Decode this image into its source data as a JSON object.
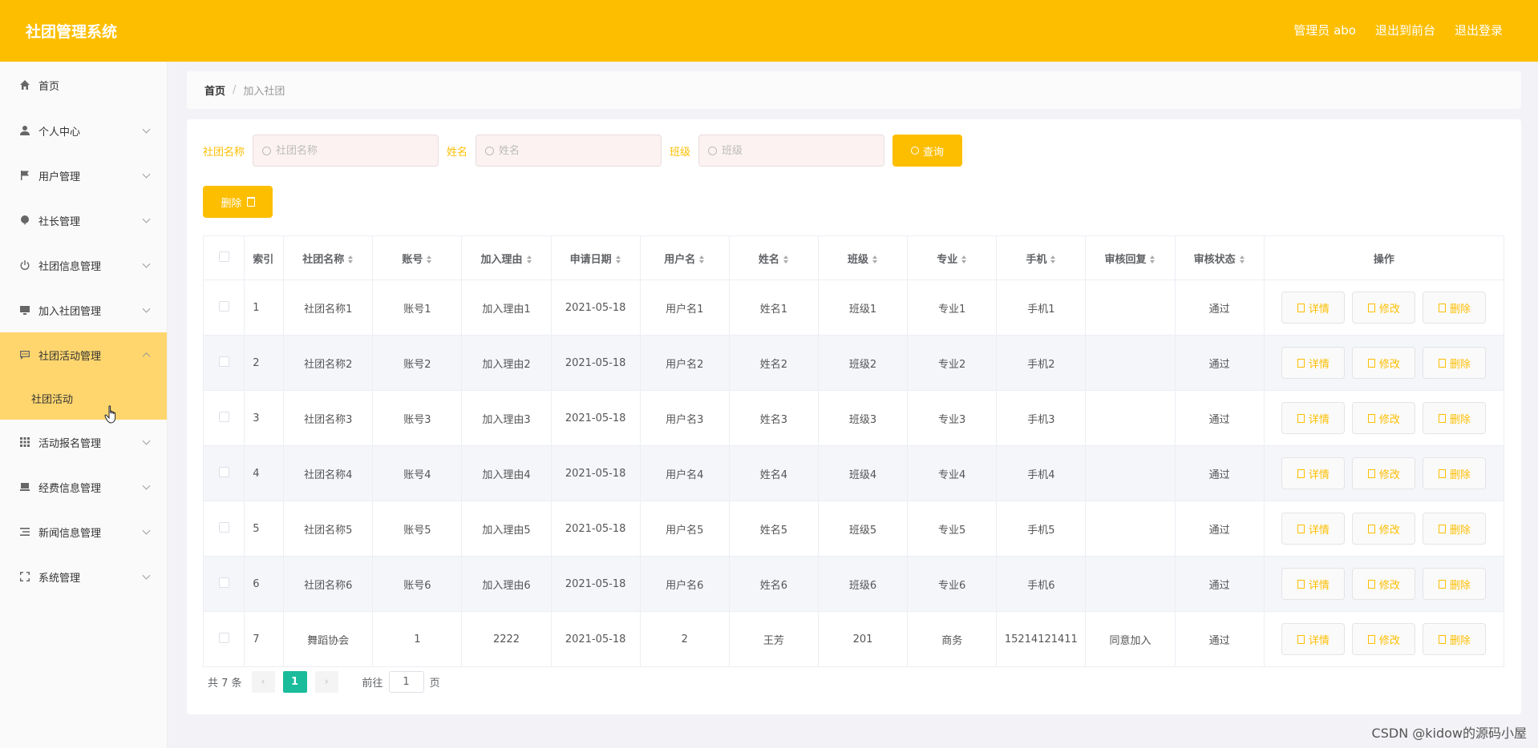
{
  "header": {
    "title": "社团管理系统",
    "admin_label": "管理员 abo",
    "to_front_label": "退出到前台",
    "logout_label": "退出登录"
  },
  "sidebar": {
    "items": [
      {
        "label": "首页",
        "icon": "home-icon"
      },
      {
        "label": "个人中心",
        "icon": "user-icon"
      },
      {
        "label": "用户管理",
        "icon": "flag-icon"
      },
      {
        "label": "社长管理",
        "icon": "balloon-icon"
      },
      {
        "label": "社团信息管理",
        "icon": "power-icon"
      },
      {
        "label": "加入社团管理",
        "icon": "monitor-icon"
      },
      {
        "label": "社团活动管理",
        "icon": "chat-icon"
      },
      {
        "label": "活动报名管理",
        "icon": "grid-icon"
      },
      {
        "label": "经费信息管理",
        "icon": "archive-icon"
      },
      {
        "label": "新闻信息管理",
        "icon": "list-icon"
      },
      {
        "label": "系统管理",
        "icon": "fullscreen-icon"
      }
    ],
    "sub_item": "社团活动"
  },
  "breadcrumb": {
    "home": "首页",
    "separator": "/",
    "current": "加入社团"
  },
  "search": {
    "club_label": "社团名称",
    "club_placeholder": "社团名称",
    "name_label": "姓名",
    "name_placeholder": "姓名",
    "class_label": "班级",
    "class_placeholder": "班级",
    "query_label": "查询"
  },
  "delete_label": "删除",
  "table": {
    "headers": [
      "索引",
      "社团名称",
      "账号",
      "加入理由",
      "申请日期",
      "用户名",
      "姓名",
      "班级",
      "专业",
      "手机",
      "审核回复",
      "审核状态",
      "操作"
    ],
    "rows": [
      {
        "index": "1",
        "club": "社团名称1",
        "account": "账号1",
        "reason": "加入理由1",
        "date": "2021-05-18",
        "username": "用户名1",
        "name": "姓名1",
        "class": "班级1",
        "major": "专业1",
        "phone": "手机1",
        "reply": "",
        "status": "通过"
      },
      {
        "index": "2",
        "club": "社团名称2",
        "account": "账号2",
        "reason": "加入理由2",
        "date": "2021-05-18",
        "username": "用户名2",
        "name": "姓名2",
        "class": "班级2",
        "major": "专业2",
        "phone": "手机2",
        "reply": "",
        "status": "通过"
      },
      {
        "index": "3",
        "club": "社团名称3",
        "account": "账号3",
        "reason": "加入理由3",
        "date": "2021-05-18",
        "username": "用户名3",
        "name": "姓名3",
        "class": "班级3",
        "major": "专业3",
        "phone": "手机3",
        "reply": "",
        "status": "通过"
      },
      {
        "index": "4",
        "club": "社团名称4",
        "account": "账号4",
        "reason": "加入理由4",
        "date": "2021-05-18",
        "username": "用户名4",
        "name": "姓名4",
        "class": "班级4",
        "major": "专业4",
        "phone": "手机4",
        "reply": "",
        "status": "通过"
      },
      {
        "index": "5",
        "club": "社团名称5",
        "account": "账号5",
        "reason": "加入理由5",
        "date": "2021-05-18",
        "username": "用户名5",
        "name": "姓名5",
        "class": "班级5",
        "major": "专业5",
        "phone": "手机5",
        "reply": "",
        "status": "通过"
      },
      {
        "index": "6",
        "club": "社团名称6",
        "account": "账号6",
        "reason": "加入理由6",
        "date": "2021-05-18",
        "username": "用户名6",
        "name": "姓名6",
        "class": "班级6",
        "major": "专业6",
        "phone": "手机6",
        "reply": "",
        "status": "通过"
      },
      {
        "index": "7",
        "club": "舞蹈协会",
        "account": "1",
        "reason": "2222",
        "date": "2021-05-18",
        "username": "2",
        "name": "王芳",
        "class": "201",
        "major": "商务",
        "phone": "15214121411",
        "reply": "同意加入",
        "status": "通过"
      }
    ],
    "actions": {
      "detail": "详情",
      "edit": "修改",
      "delete": "删除"
    }
  },
  "pagination": {
    "total": "共 7 条",
    "current_page": "1",
    "goto_label": "前往",
    "goto_value": "1",
    "page_suffix": "页"
  },
  "watermark": "CSDN @kidow的源码小屋",
  "colors": {
    "accent": "#fdbe00",
    "page_active": "#1abc9c",
    "submenu_bg": "#ffd66e"
  }
}
